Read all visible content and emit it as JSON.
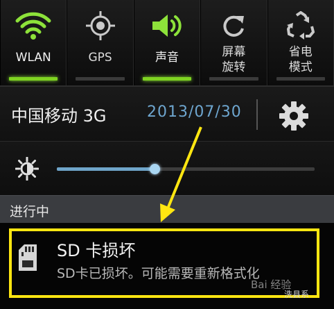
{
  "quick_settings": [
    {
      "label": "WLAN",
      "icon": "wifi-icon",
      "active": true
    },
    {
      "label": "GPS",
      "icon": "gps-icon",
      "active": false
    },
    {
      "label": "声音",
      "icon": "sound-icon",
      "active": true
    },
    {
      "label_line1": "屏幕",
      "label_line2": "旋转",
      "icon": "rotate-icon",
      "active": false
    },
    {
      "label_line1": "省电",
      "label_line2": "模式",
      "icon": "recycle-icon",
      "active": false
    }
  ],
  "status": {
    "carrier": "中国移动 3G",
    "date": "2013/07/30"
  },
  "brightness": {
    "level": 0.38
  },
  "ongoing_header": "进行中",
  "notification": {
    "title": "SD 卡损坏",
    "text": "SD卡已损坏。可能需要重新格式化",
    "watermark_1": "Bai 经验",
    "watermark_2": "洗县系"
  },
  "colors": {
    "active_bar": "#7ed321",
    "highlight_box": "#ffe611",
    "annotation_arrow": "#ffe611",
    "date_text": "#6ea6cf"
  }
}
